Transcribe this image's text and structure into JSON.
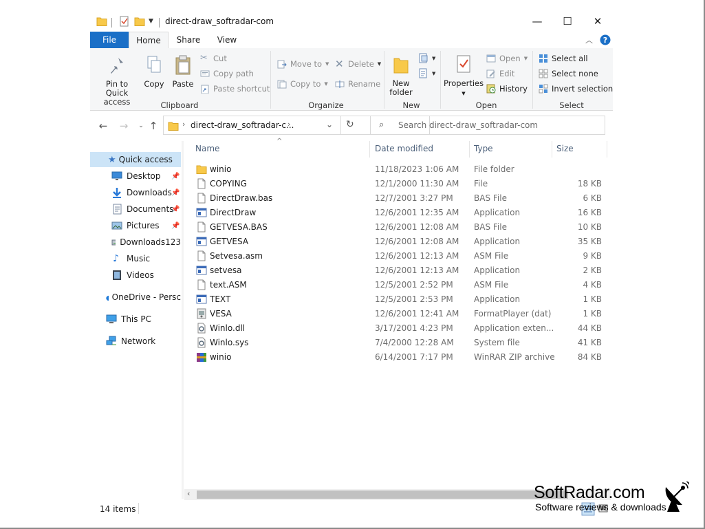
{
  "window": {
    "title": "direct-draw_softradar-com",
    "minimize_glyph": "—",
    "maximize_glyph": "☐",
    "close_glyph": "✕"
  },
  "ribbon": {
    "tabs": [
      {
        "label": "File"
      },
      {
        "label": "Home"
      },
      {
        "label": "Share"
      },
      {
        "label": "View"
      }
    ],
    "clipboard": {
      "pin_label": "Pin to Quick access",
      "copy_label": "Copy",
      "paste_label": "Paste",
      "cut_label": "Cut",
      "copy_path_label": "Copy path",
      "paste_shortcut_label": "Paste shortcut",
      "group_label": "Clipboard"
    },
    "organize": {
      "move_to_label": "Move to",
      "copy_to_label": "Copy to",
      "delete_label": "Delete",
      "rename_label": "Rename",
      "group_label": "Organize"
    },
    "new": {
      "new_folder_label": "New folder",
      "group_label": "New"
    },
    "open": {
      "properties_label": "Properties",
      "open_label": "Open",
      "edit_label": "Edit",
      "history_label": "History",
      "group_label": "Open"
    },
    "select": {
      "select_all_label": "Select all",
      "select_none_label": "Select none",
      "invert_label": "Invert selection",
      "group_label": "Select"
    }
  },
  "address": {
    "path": "direct-draw_softradar-c...",
    "search_placeholder": "Search direct-draw_softradar-com"
  },
  "nav": {
    "quick_access": "Quick access",
    "items": [
      {
        "label": "Desktop",
        "pinned": true
      },
      {
        "label": "Downloads",
        "pinned": true
      },
      {
        "label": "Documents",
        "pinned": true
      },
      {
        "label": "Pictures",
        "pinned": true
      },
      {
        "label": "Downloads123",
        "pinned": false
      },
      {
        "label": "Music",
        "pinned": false
      },
      {
        "label": "Videos",
        "pinned": false
      }
    ],
    "onedrive": "OneDrive - Persc",
    "this_pc": "This PC",
    "network": "Network"
  },
  "columns": {
    "name": "Name",
    "date": "Date modified",
    "type": "Type",
    "size": "Size"
  },
  "files": [
    {
      "name": "winio",
      "date": "11/18/2023 1:06 AM",
      "type": "File folder",
      "size": "",
      "icon": "folder-icon"
    },
    {
      "name": "COPYING",
      "date": "12/1/2000 11:30 AM",
      "type": "File",
      "size": "18 KB",
      "icon": "file-icon"
    },
    {
      "name": "DirectDraw.bas",
      "date": "12/7/2001 3:27 PM",
      "type": "BAS File",
      "size": "6 KB",
      "icon": "file-icon"
    },
    {
      "name": "DirectDraw",
      "date": "12/6/2001 12:35 AM",
      "type": "Application",
      "size": "16 KB",
      "icon": "app-icon"
    },
    {
      "name": "GETVESA.BAS",
      "date": "12/6/2001 12:08 AM",
      "type": "BAS File",
      "size": "10 KB",
      "icon": "file-icon"
    },
    {
      "name": "GETVESA",
      "date": "12/6/2001 12:08 AM",
      "type": "Application",
      "size": "35 KB",
      "icon": "app-icon"
    },
    {
      "name": "Setvesa.asm",
      "date": "12/6/2001 12:13 AM",
      "type": "ASM File",
      "size": "9 KB",
      "icon": "file-icon"
    },
    {
      "name": "setvesa",
      "date": "12/6/2001 12:13 AM",
      "type": "Application",
      "size": "2 KB",
      "icon": "app-icon"
    },
    {
      "name": "text.ASM",
      "date": "12/5/2001 2:52 PM",
      "type": "ASM File",
      "size": "4 KB",
      "icon": "file-icon"
    },
    {
      "name": "TEXT",
      "date": "12/5/2001 2:53 PM",
      "type": "Application",
      "size": "1 KB",
      "icon": "app-icon"
    },
    {
      "name": "VESA",
      "date": "12/6/2001 12:41 AM",
      "type": "FormatPlayer (dat)",
      "size": "1 KB",
      "icon": "dat-icon"
    },
    {
      "name": "Winlo.dll",
      "date": "3/17/2001 4:23 PM",
      "type": "Application exten...",
      "size": "44 KB",
      "icon": "dll-icon"
    },
    {
      "name": "Winlo.sys",
      "date": "7/4/2000 12:28 AM",
      "type": "System file",
      "size": "41 KB",
      "icon": "sys-icon"
    },
    {
      "name": "winio",
      "date": "6/14/2001 7:17 PM",
      "type": "WinRAR ZIP archive",
      "size": "84 KB",
      "icon": "zip-icon"
    }
  ],
  "status": {
    "item_count": "14 items"
  },
  "watermark": {
    "title": "SoftRadar.com",
    "subtitle": "Software reviews & downloads"
  },
  "colors": {
    "accent": "#1a6fc7",
    "selection": "#cce4f7",
    "folder": "#f8c94a"
  }
}
